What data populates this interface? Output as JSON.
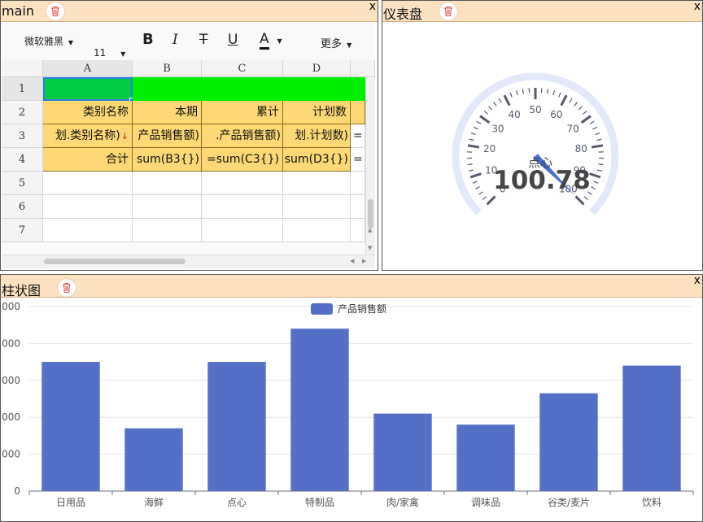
{
  "panels": {
    "main": {
      "title": "main",
      "close": "x"
    },
    "gauge": {
      "title": "仪表盘",
      "close": "x"
    },
    "bar": {
      "title": "柱状图",
      "close": "x"
    }
  },
  "toolbar": {
    "font": "微软雅黑",
    "size": "11",
    "bold": "B",
    "italic": "I",
    "strike": "T",
    "underline": "U",
    "color_a": "A",
    "more": "更多"
  },
  "sheet": {
    "columns": [
      "A",
      "B",
      "C",
      "D"
    ],
    "rows": [
      "1",
      "2",
      "3",
      "4",
      "5",
      "6",
      "7"
    ],
    "row2": [
      "类别名称",
      "本期",
      "累计",
      "计划数"
    ],
    "row3": [
      "划.类别名称)",
      "产品销售额)",
      ".产品销售额)",
      "划.计划数)",
      "="
    ],
    "row4": [
      "合计",
      "sum(B3{})",
      "=sum(C3{})",
      "sum(D3{})",
      "="
    ],
    "colors": {
      "a1": "#00cc44",
      "row1": "#00ee00",
      "yellow": "#fed874"
    }
  },
  "gauge": {
    "label": "点心",
    "value": "100.78",
    "min": 0,
    "max": 100,
    "ticks": [
      "0",
      "10",
      "20",
      "30",
      "40",
      "50",
      "60",
      "70",
      "80",
      "90",
      "100"
    ],
    "needle_value": 100.78,
    "colors": {
      "ring": "#e3e9fb",
      "needle": "#4a6fd6",
      "tick": "#555a6e"
    }
  },
  "chart_data": {
    "type": "bar",
    "legend": "产品销售额",
    "categories": [
      "日用品",
      "海鲜",
      "点心",
      "特制品",
      "肉/家禽",
      "调味品",
      "谷类/麦片",
      "饮料"
    ],
    "values": [
      3500,
      1700,
      3500,
      4400,
      2100,
      1800,
      2650,
      3400
    ],
    "yticks": [
      "0",
      "000",
      "000",
      "000",
      "000",
      "000"
    ],
    "ylim": [
      0,
      5000
    ],
    "color": "#5470c6"
  }
}
